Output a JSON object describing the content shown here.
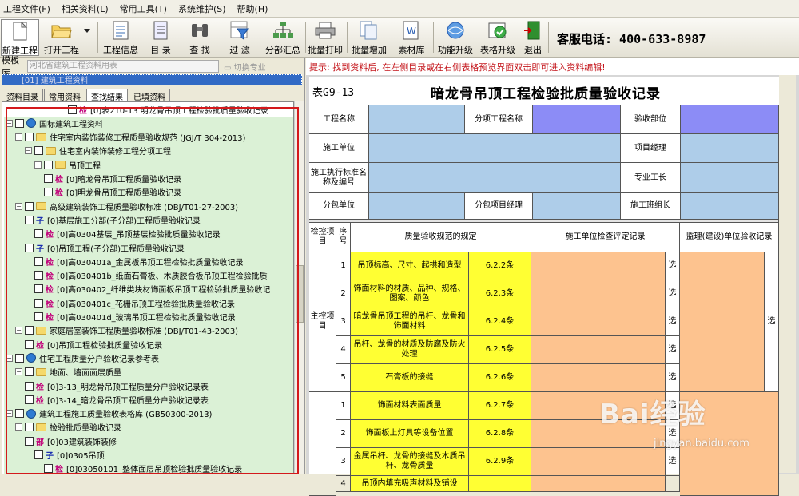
{
  "menu": [
    "工程文件(F)",
    "相关资料(L)",
    "常用工具(T)",
    "系统维护(S)",
    "帮助(H)"
  ],
  "toolbar": [
    {
      "label": "新建工程",
      "icon": "new-project-icon"
    },
    {
      "label": "打开工程",
      "icon": "open-folder-icon"
    },
    {
      "label": "工程信息",
      "icon": "project-info-icon"
    },
    {
      "label": "目 录",
      "icon": "catalog-icon"
    },
    {
      "label": "查 找",
      "icon": "binoculars-icon"
    },
    {
      "label": "过 滤",
      "icon": "filter-funnel-icon"
    },
    {
      "label": "分部汇总",
      "icon": "summary-tree-icon"
    },
    {
      "label": "批量打印",
      "icon": "printer-icon"
    },
    {
      "label": "批量增加",
      "icon": "batch-add-icon"
    },
    {
      "label": "素材库",
      "icon": "material-library-icon"
    },
    {
      "label": "功能升级",
      "icon": "function-upgrade-icon"
    },
    {
      "label": "表格升级",
      "icon": "table-upgrade-icon"
    },
    {
      "label": "退出",
      "icon": "exit-door-icon"
    }
  ],
  "phone": "客服电话: 400-633-8987",
  "left": {
    "template_label": "模板库",
    "template_value": "河北省建筑工程资料用表",
    "switch_label": "切换专业",
    "root": "[01] 建筑工程资料",
    "tabs": [
      "资料目录",
      "常用资料",
      "查找结果",
      "已填资料"
    ],
    "active_tab": 2,
    "tree": [
      {
        "indent": 6,
        "tag": "检",
        "text": "[0]表210-13 明龙骨吊顶工程检验批质量验收记录"
      },
      {
        "indent": 0,
        "type": "globe",
        "text": "国标建筑工程资料"
      },
      {
        "indent": 1,
        "type": "folder",
        "text": "住宅室内装饰装修工程质量验收规范 (JGJ/T 304-2013)"
      },
      {
        "indent": 2,
        "type": "folder",
        "text": "住宅室内装饰装修工程分项工程"
      },
      {
        "indent": 3,
        "type": "folder",
        "text": "吊顶工程"
      },
      {
        "indent": 4,
        "tag": "检",
        "text": "[0]暗龙骨吊顶工程质量验收记录"
      },
      {
        "indent": 4,
        "tag": "检",
        "text": "[0]明龙骨吊顶工程质量验收记录"
      },
      {
        "indent": 1,
        "type": "folder",
        "text": "高级建筑装饰工程质量验收标准 (DBJ/T01-27-2003)"
      },
      {
        "indent": 2,
        "tag": "子",
        "text": "[0]基层施工分部(子分部)工程质量验收记录"
      },
      {
        "indent": 3,
        "tag": "检",
        "text": "[0]高0304基层_吊顶基层检验批质量验收记录"
      },
      {
        "indent": 2,
        "tag": "子",
        "text": "[0]吊顶工程(子分部)工程质量验收记录"
      },
      {
        "indent": 3,
        "tag": "检",
        "text": "[0]高030401a_金属板吊顶工程检验批质量验收记录"
      },
      {
        "indent": 3,
        "tag": "检",
        "text": "[0]高030401b_纸面石膏板、木质胶合板吊顶工程检验批质"
      },
      {
        "indent": 3,
        "tag": "检",
        "text": "[0]高030402_纤维类块材饰面板吊顶工程检验批质量验收记"
      },
      {
        "indent": 3,
        "tag": "检",
        "text": "[0]高030401c_花栅吊顶工程检验批质量验收记录"
      },
      {
        "indent": 3,
        "tag": "检",
        "text": "[0]高030401d_玻璃吊顶工程检验批质量验收记录"
      },
      {
        "indent": 1,
        "type": "folder",
        "text": "家庭居室装饰工程质量验收标准 (DBJ/T01-43-2003)"
      },
      {
        "indent": 2,
        "tag": "检",
        "text": "[0]吊顶工程检验批质量验收记录"
      },
      {
        "indent": 0,
        "type": "globe",
        "text": "住宅工程质量分户验收记录参考表"
      },
      {
        "indent": 1,
        "type": "folder",
        "text": "地面、墙面面层质量"
      },
      {
        "indent": 2,
        "tag": "检",
        "text": "[0]3-13_明龙骨吊顶工程质量分户验收记录表"
      },
      {
        "indent": 2,
        "tag": "检",
        "text": "[0]3-14_暗龙骨吊顶工程质量分户验收记录表"
      },
      {
        "indent": 0,
        "type": "globe",
        "text": "建筑工程施工质量验收表格库 (GB50300-2013)"
      },
      {
        "indent": 1,
        "type": "folder",
        "text": "检验批质量验收记录"
      },
      {
        "indent": 2,
        "tag": "部",
        "text": "[0]03建筑装饰装修"
      },
      {
        "indent": 3,
        "tag": "子",
        "text": "[0]0305吊顶"
      },
      {
        "indent": 4,
        "tag": "检",
        "text": "[0]03050101_整体面层吊顶检验批质量验收记录"
      }
    ]
  },
  "right": {
    "tip": "提示: 找到资料后, 在左侧目录或在右侧表格预览界面双击即可进入资料编辑!",
    "form_no": "表G9-13",
    "form_title": "暗龙骨吊顶工程检验批质量验收记录",
    "labels": {
      "project_name": "工程名称",
      "sub_project_name": "分项工程名称",
      "acceptance_part": "验收部位",
      "construction_unit": "施工单位",
      "project_manager": "项目经理",
      "standard": "施工执行标准名称及编号",
      "foreman": "专业工长",
      "subcontractor": "分包单位",
      "sub_manager": "分包项目经理",
      "team_leader": "施工班组长",
      "item_col": "检控项目",
      "seq_col": "序号",
      "spec_col": "质量验收规范的规定",
      "check_col": "施工单位检查评定记录",
      "super_col": "监理(建设)单位验收记录",
      "main_group": "主控项目",
      "select": "选"
    },
    "rows": [
      {
        "no": "1",
        "text": "吊顶标高、尺寸、起拱和造型",
        "clause": "6.2.2条"
      },
      {
        "no": "2",
        "text": "饰面材料的材质、品种、规格、图案、颜色",
        "clause": "6.2.3条"
      },
      {
        "no": "3",
        "text": "暗龙骨吊顶工程的吊杆、龙骨和饰面材料",
        "clause": "6.2.4条"
      },
      {
        "no": "4",
        "text": "吊杆、龙骨的材质及防腐及防火处理",
        "clause": "6.2.5条"
      },
      {
        "no": "5",
        "text": "石膏板的接缝",
        "clause": "6.2.6条"
      },
      {
        "no": "1",
        "text": "饰面材料表面质量",
        "clause": "6.2.7条"
      },
      {
        "no": "2",
        "text": "饰面板上灯具等设备位置",
        "clause": "6.2.8条"
      },
      {
        "no": "3",
        "text": "金属吊杆、龙骨的接缝及木质吊杆、龙骨质量",
        "clause": "6.2.9条"
      },
      {
        "no": "4",
        "text": "吊顶内填充吸声材料及铺设",
        "clause": ""
      }
    ]
  },
  "watermark": {
    "brand": "Bai经验",
    "url": "jingyan.baidu.com"
  },
  "colors": {
    "blue": "#aecde9",
    "purple": "#8c8cf6",
    "yellow": "#ffff33",
    "peach": "#fdc38f",
    "highlight": "#316ac5",
    "tip_red": "#c4151b"
  }
}
